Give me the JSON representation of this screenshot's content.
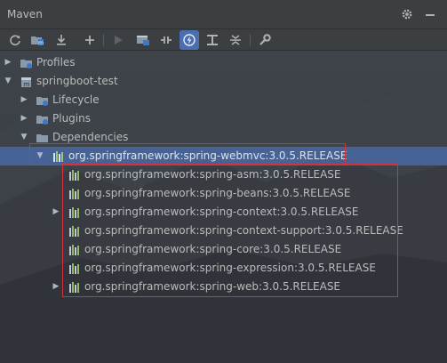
{
  "panel": {
    "title": "Maven"
  },
  "title_icons": [
    "gear-icon",
    "minimize-icon"
  ],
  "toolbar_icons": [
    "refresh-icon",
    "add-maven-projects-icon",
    "download-icon",
    "plus-icon",
    "run-icon",
    "execute-goal-icon",
    "toggle-offline-icon",
    "skip-tests-icon",
    "show-dependencies-icon",
    "collapse-all-icon",
    "settings-wrench-icon"
  ],
  "tree": {
    "profiles": "Profiles",
    "project": "springboot-test",
    "lifecycle": "Lifecycle",
    "plugins": "Plugins",
    "dependencies": "Dependencies",
    "selected_dependency": "org.springframework:spring-webmvc:3.0.5.RELEASE",
    "children": [
      "org.springframework:spring-asm:3.0.5.RELEASE",
      "org.springframework:spring-beans:3.0.5.RELEASE",
      "org.springframework:spring-context:3.0.5.RELEASE",
      "org.springframework:spring-context-support:3.0.5.RELEASE",
      "org.springframework:spring-core:3.0.5.RELEASE",
      "org.springframework:spring-expression:3.0.5.RELEASE",
      "org.springframework:spring-web:3.0.5.RELEASE"
    ]
  },
  "colors": {
    "selection": "#4b6eaf",
    "highlight_box": "#d2343e",
    "panel": "#3c3f41"
  }
}
